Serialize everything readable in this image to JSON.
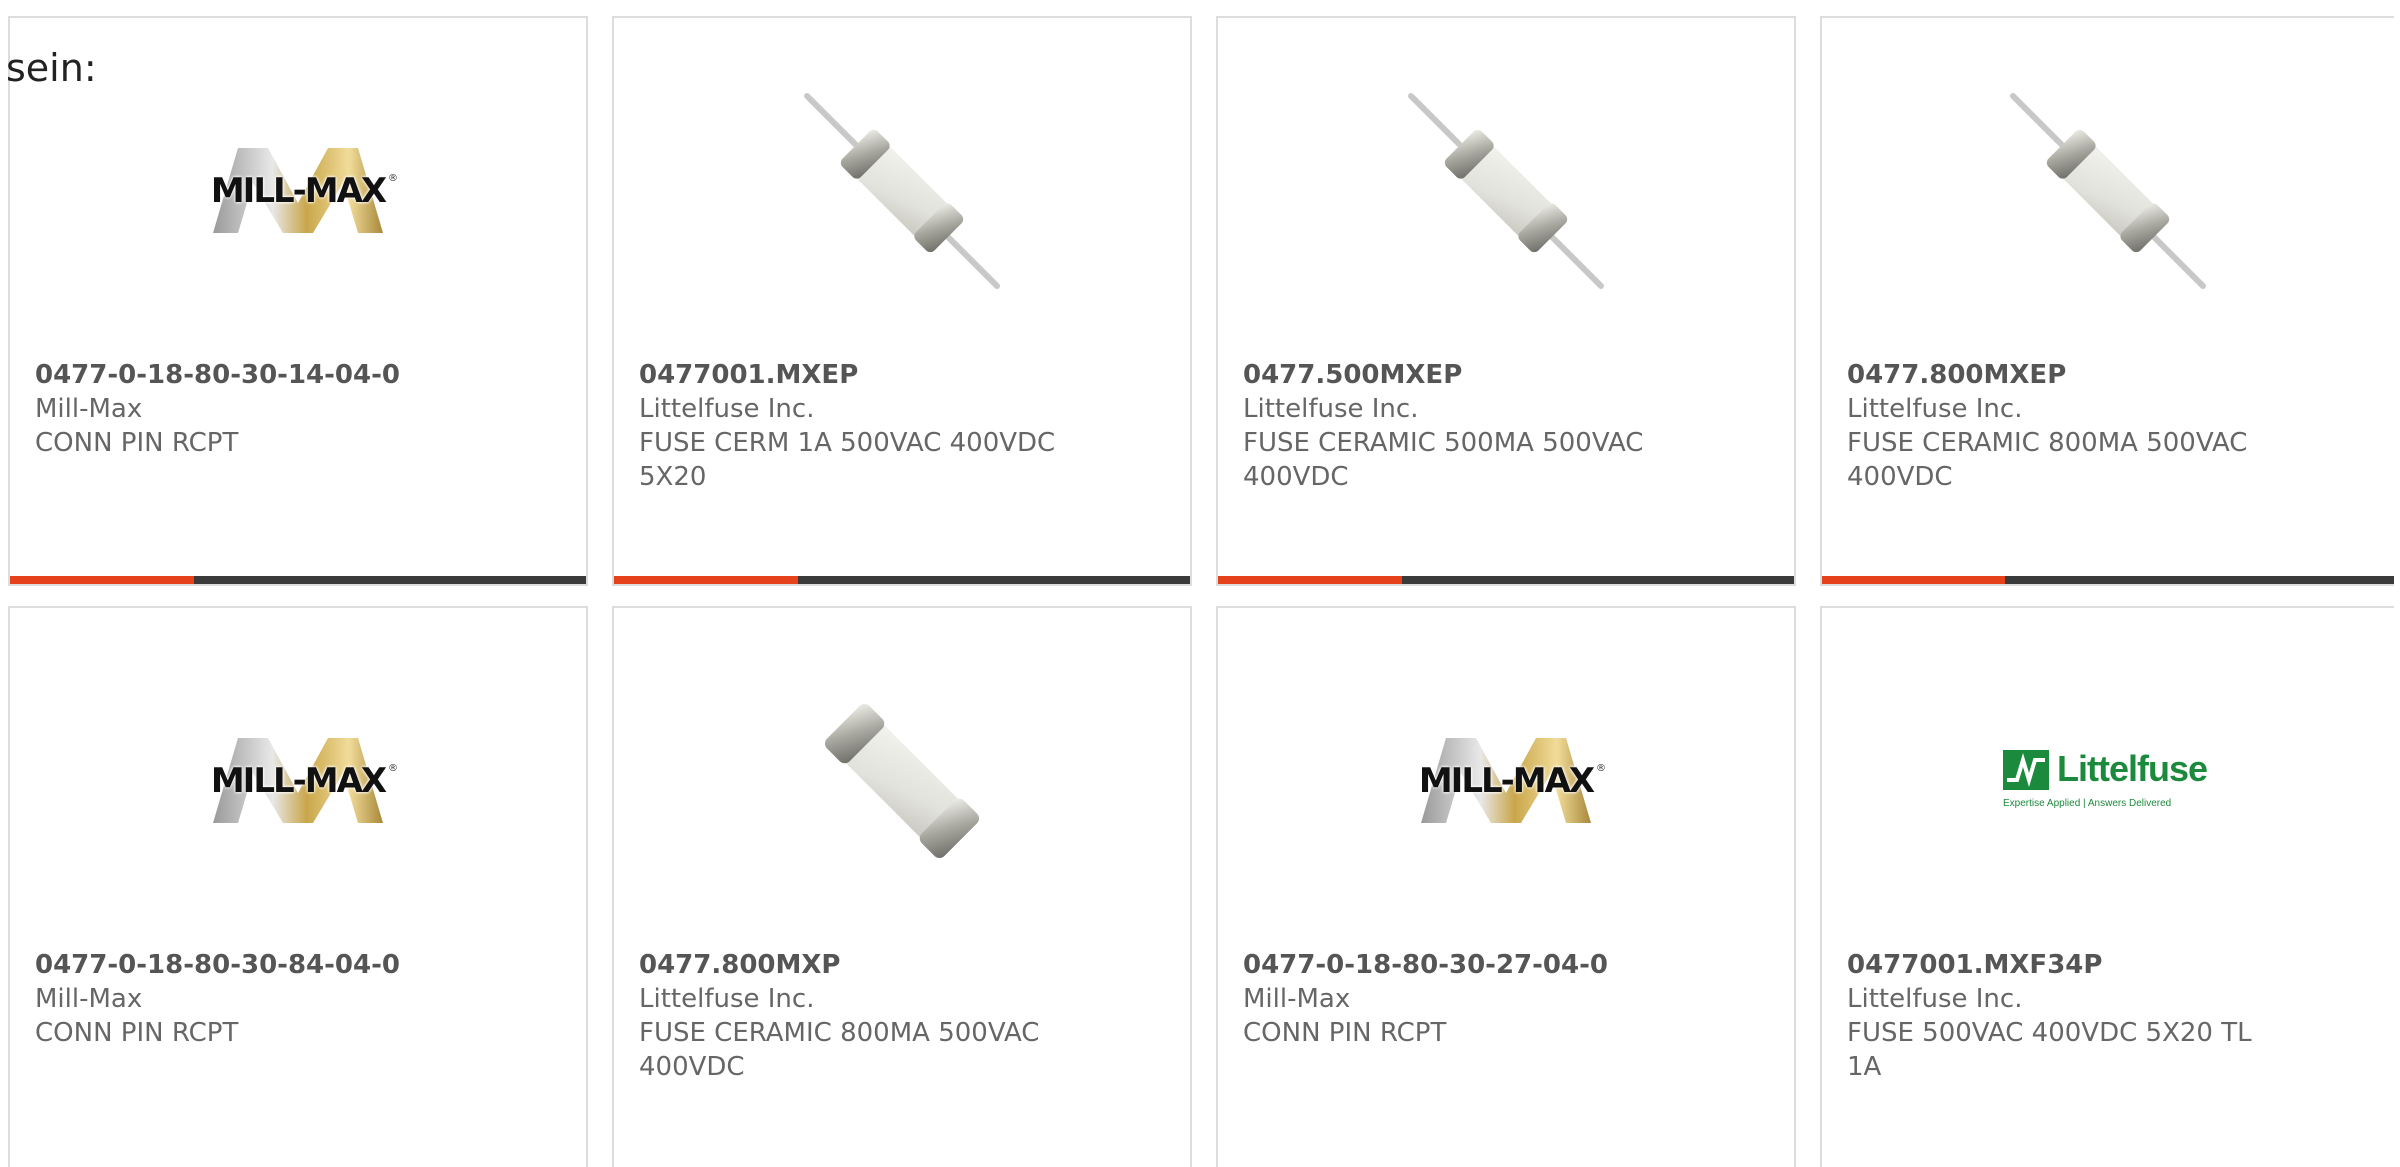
{
  "intro": {
    "text": "sein:"
  },
  "products": [
    {
      "part_number": "0477-0-18-80-30-14-04-0",
      "manufacturer": "Mill-Max",
      "description": "CONN PIN RCPT",
      "image": "mill-max-logo",
      "progress": 0.32
    },
    {
      "part_number": "0477001.MXEP",
      "manufacturer": "Littelfuse Inc.",
      "description": "FUSE CERM 1A 500VAC 400VDC 5X20",
      "image": "axial-fuse-photo",
      "progress": 0.32
    },
    {
      "part_number": "0477.500MXEP",
      "manufacturer": "Littelfuse Inc.",
      "description": "FUSE CERAMIC 500MA 500VAC 400VDC",
      "image": "axial-fuse-photo",
      "progress": 0.32
    },
    {
      "part_number": "0477.800MXEP",
      "manufacturer": "Littelfuse Inc.",
      "description": "FUSE CERAMIC 800MA 500VAC 400VDC",
      "image": "axial-fuse-photo",
      "progress": 0.32
    },
    {
      "part_number": "0477-0-18-80-30-84-04-0",
      "manufacturer": "Mill-Max",
      "description": "CONN PIN RCPT",
      "image": "mill-max-logo"
    },
    {
      "part_number": "0477.800MXP",
      "manufacturer": "Littelfuse Inc.",
      "description": "FUSE CERAMIC 800MA 500VAC 400VDC",
      "image": "cartridge-fuse-photo"
    },
    {
      "part_number": "0477-0-18-80-30-27-04-0",
      "manufacturer": "Mill-Max",
      "description": "CONN PIN RCPT",
      "image": "mill-max-logo"
    },
    {
      "part_number": "0477001.MXF34P",
      "manufacturer": "Littelfuse Inc.",
      "description": "FUSE 500VAC 400VDC 5X20 TL 1A",
      "image": "littelfuse-logo"
    }
  ],
  "logos": {
    "millmax_word": "MILL-MAX",
    "littelfuse_word": "Littelfuse",
    "littelfuse_tagline": "Expertise Applied | Answers Delivered"
  },
  "colors": {
    "progress_fill": "#e5421c",
    "progress_track": "#3a3a3a",
    "card_border": "#dddddd",
    "text": "#666666",
    "littelfuse_green": "#1c8a3c"
  }
}
